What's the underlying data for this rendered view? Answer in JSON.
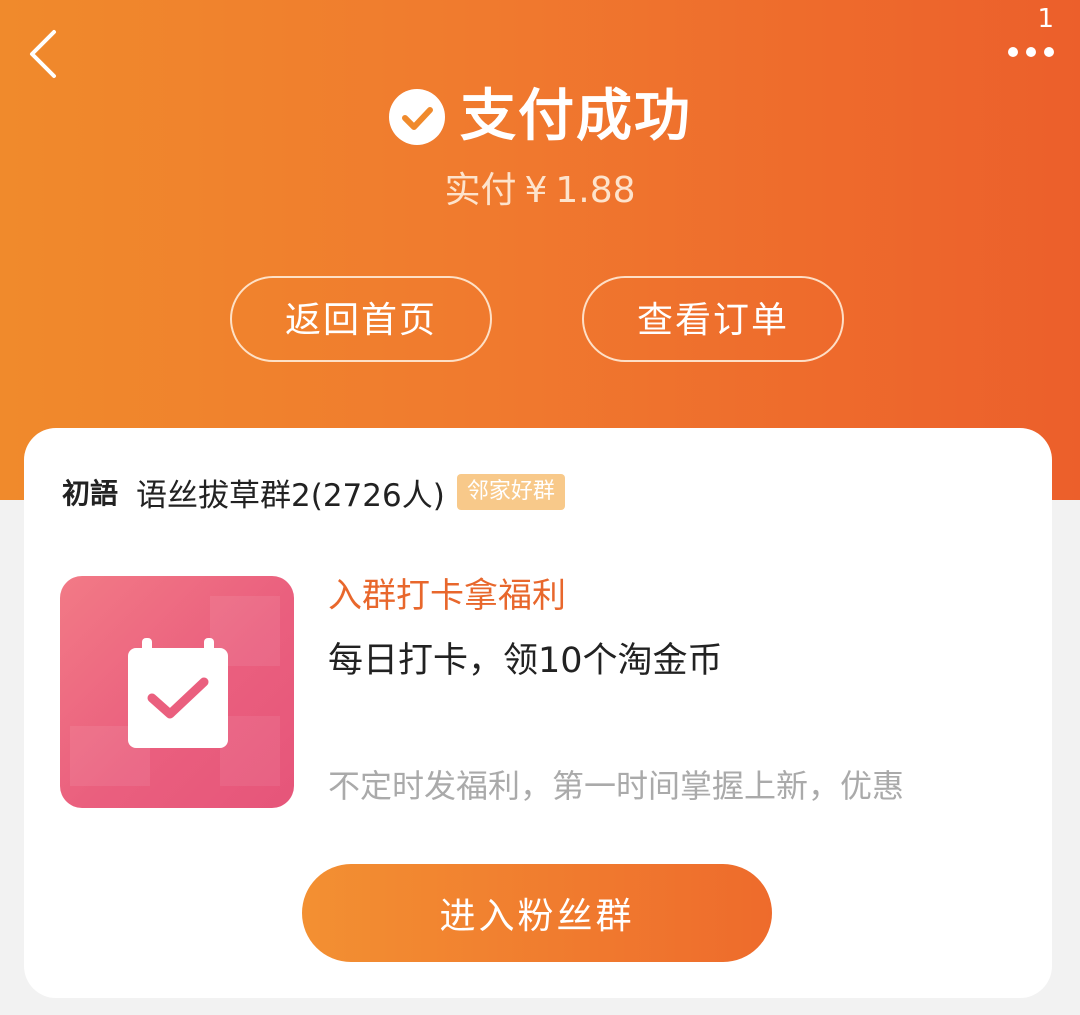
{
  "header": {
    "badge": "1",
    "title": "支付成功",
    "paid_label": "实付",
    "currency": "¥",
    "amount": "1.88",
    "home_button": "返回首页",
    "order_button": "查看订单"
  },
  "card": {
    "shop_name": "初語",
    "group_name": "语丝拔草群2(2726人)",
    "tag": "邻家好群",
    "benefit_title": "入群打卡拿福利",
    "benefit_main": "每日打卡，领10个淘金币",
    "benefit_sub": "不定时发福利，第一时间掌握上新，优惠",
    "join_button": "进入粉丝群",
    "tile_icon": "calendar-check-icon"
  },
  "colors": {
    "header_start": "#f08a2c",
    "header_end": "#ec5f2b",
    "accent_text": "#e8672c",
    "tag_bg": "#f8c98a",
    "tile_pink": "#ea5f7e"
  }
}
